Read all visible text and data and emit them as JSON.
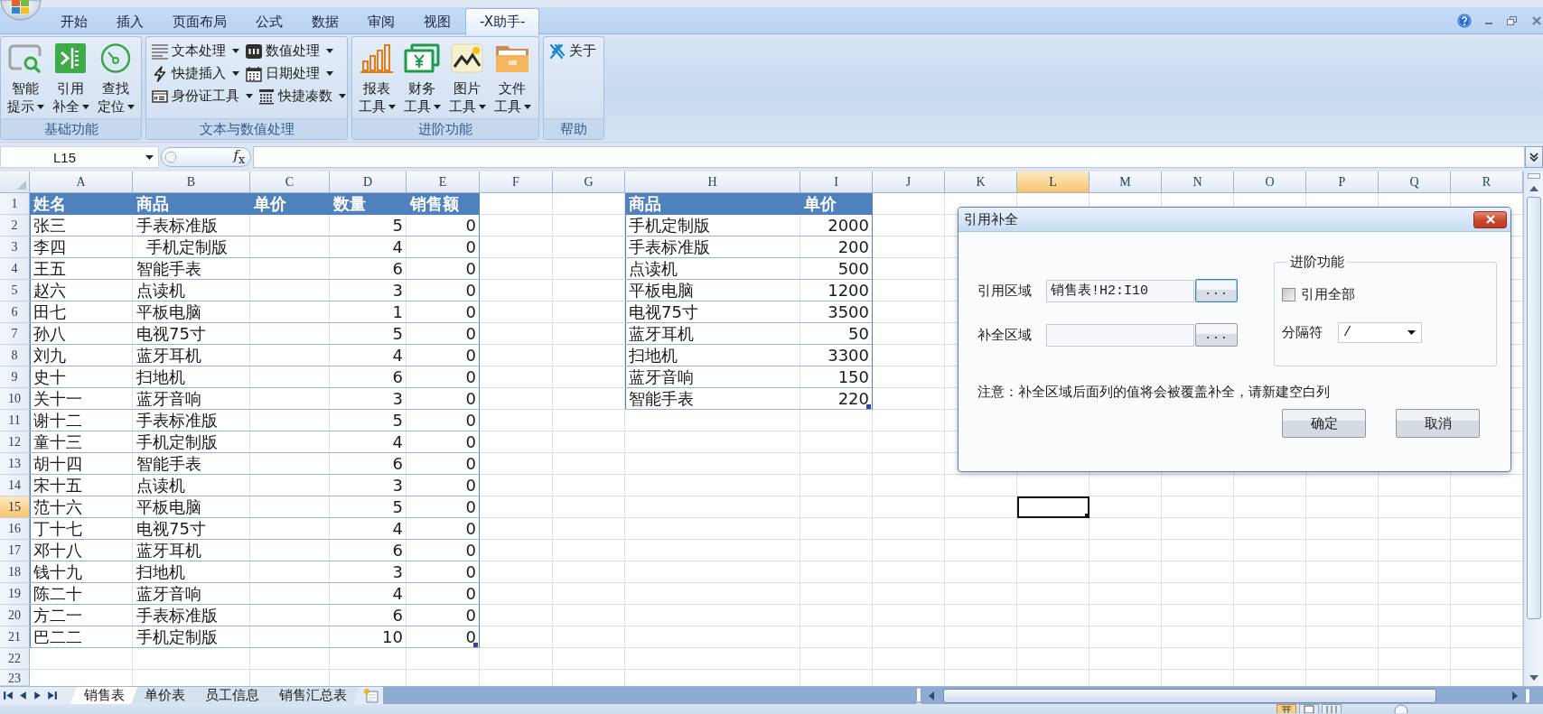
{
  "ribbon_tabs": [
    {
      "label": "开始",
      "selected": false
    },
    {
      "label": "插入",
      "selected": false
    },
    {
      "label": "页面布局",
      "selected": false
    },
    {
      "label": "公式",
      "selected": false
    },
    {
      "label": "数据",
      "selected": false
    },
    {
      "label": "审阅",
      "selected": false
    },
    {
      "label": "视图",
      "selected": false
    },
    {
      "label": "-X助手-",
      "selected": true
    }
  ],
  "ribbon_groups": [
    {
      "title": "基础功能",
      "kind": "large",
      "items": [
        {
          "lines": [
            "智能",
            "提示"
          ],
          "dropdown": true
        },
        {
          "lines": [
            "引用",
            "补全"
          ],
          "dropdown": true
        },
        {
          "lines": [
            "查找",
            "定位"
          ],
          "dropdown": true
        }
      ]
    },
    {
      "title": "文本与数值处理",
      "kind": "small",
      "items": [
        {
          "label": "文本处理",
          "dropdown": true
        },
        {
          "label": "数值处理",
          "dropdown": true
        },
        {
          "label": "快捷插入",
          "dropdown": true
        },
        {
          "label": "日期处理",
          "dropdown": true
        },
        {
          "label": "身份证工具",
          "dropdown": true
        },
        {
          "label": "快捷凑数",
          "dropdown": true
        }
      ]
    },
    {
      "title": "进阶功能",
      "kind": "large",
      "items": [
        {
          "lines": [
            "报表",
            "工具"
          ],
          "dropdown": true
        },
        {
          "lines": [
            "财务",
            "工具"
          ],
          "dropdown": true
        },
        {
          "lines": [
            "图片",
            "工具"
          ],
          "dropdown": true
        },
        {
          "lines": [
            "文件",
            "工具"
          ],
          "dropdown": true
        }
      ]
    },
    {
      "title": "帮助",
      "kind": "small",
      "items": [
        {
          "label": "关于",
          "dropdown": false
        }
      ]
    }
  ],
  "name_box": {
    "value": "L15"
  },
  "formula_bar": {
    "function_label": "*f*$_{x}$"
  },
  "sheet": {
    "columns": [
      {
        "label": "A",
        "selected": false
      },
      {
        "label": "B",
        "selected": false
      },
      {
        "label": "C",
        "selected": false
      },
      {
        "label": "D",
        "selected": false
      },
      {
        "label": "E",
        "selected": false
      },
      {
        "label": "F",
        "selected": false
      },
      {
        "label": "G",
        "selected": false
      },
      {
        "label": "H",
        "selected": false
      },
      {
        "label": "I",
        "selected": false
      },
      {
        "label": "J",
        "selected": false
      },
      {
        "label": "K",
        "selected": false
      },
      {
        "label": "L",
        "selected": true
      },
      {
        "label": "M",
        "selected": false
      },
      {
        "label": "N",
        "selected": false
      },
      {
        "label": "O",
        "selected": false
      },
      {
        "label": "P",
        "selected": false
      },
      {
        "label": "Q",
        "selected": false
      },
      {
        "label": "R",
        "selected": false
      }
    ],
    "row_headers": [
      {
        "label": "1",
        "selected": false
      },
      {
        "label": "2",
        "selected": false
      },
      {
        "label": "3",
        "selected": false
      },
      {
        "label": "4",
        "selected": false
      },
      {
        "label": "5",
        "selected": false
      },
      {
        "label": "6",
        "selected": false
      },
      {
        "label": "7",
        "selected": false
      },
      {
        "label": "8",
        "selected": false
      },
      {
        "label": "9",
        "selected": false
      },
      {
        "label": "10",
        "selected": false
      },
      {
        "label": "11",
        "selected": false
      },
      {
        "label": "12",
        "selected": false
      },
      {
        "label": "13",
        "selected": false
      },
      {
        "label": "14",
        "selected": false
      },
      {
        "label": "15",
        "selected": true
      },
      {
        "label": "16",
        "selected": false
      },
      {
        "label": "17",
        "selected": false
      },
      {
        "label": "18",
        "selected": false
      },
      {
        "label": "19",
        "selected": false
      },
      {
        "label": "20",
        "selected": false
      },
      {
        "label": "21",
        "selected": false
      },
      {
        "label": "22",
        "selected": false
      },
      {
        "label": "23",
        "selected": false
      }
    ],
    "tables": [
      {
        "columns": [
          {
            "header": "姓名",
            "kind": "text"
          },
          {
            "header": "商品",
            "kind": "text"
          },
          {
            "header": "单价",
            "kind": "number"
          },
          {
            "header": "数量",
            "kind": "number"
          },
          {
            "header": "销售额",
            "kind": "number"
          }
        ],
        "rows": [
          [
            "张三",
            "手表标准版",
            null,
            "5",
            "0"
          ],
          [
            "李四",
            "  手机定制版",
            null,
            "4",
            "0"
          ],
          [
            "王五",
            "智能手表",
            null,
            "6",
            "0"
          ],
          [
            "赵六",
            "点读机",
            null,
            "3",
            "0"
          ],
          [
            "田七",
            "平板电脑",
            null,
            "1",
            "0"
          ],
          [
            "孙八",
            "电视75寸",
            null,
            "5",
            "0"
          ],
          [
            "刘九",
            "蓝牙耳机",
            null,
            "4",
            "0"
          ],
          [
            "史十",
            "扫地机",
            null,
            "6",
            "0"
          ],
          [
            "关十一",
            "蓝牙音响",
            null,
            "3",
            "0"
          ],
          [
            "谢十二",
            "手表标准版",
            null,
            "5",
            "0"
          ],
          [
            "童十三",
            "手机定制版",
            null,
            "4",
            "0"
          ],
          [
            "胡十四",
            "智能手表",
            null,
            "6",
            "0"
          ],
          [
            "宋十五",
            "点读机",
            null,
            "3",
            "0"
          ],
          [
            "范十六",
            "平板电脑",
            null,
            "5",
            "0"
          ],
          [
            "丁十七",
            "电视75寸",
            null,
            "4",
            "0"
          ],
          [
            "邓十八",
            "蓝牙耳机",
            null,
            "6",
            "0"
          ],
          [
            "钱十九",
            "扫地机",
            null,
            "3",
            "0"
          ],
          [
            "陈二十",
            "蓝牙音响",
            null,
            "4",
            "0"
          ],
          [
            "方二一",
            "手表标准版",
            null,
            "6",
            "0"
          ],
          [
            "巴二二",
            "手机定制版",
            null,
            "10",
            "0"
          ]
        ]
      },
      {
        "columns": [
          {
            "header": "商品",
            "kind": "text"
          },
          {
            "header": "单价",
            "kind": "number"
          }
        ],
        "rows": [
          [
            "手机定制版",
            "2000"
          ],
          [
            "手表标准版",
            "200"
          ],
          [
            "点读机",
            "500"
          ],
          [
            "平板电脑",
            "1200"
          ],
          [
            "电视75寸",
            "3500"
          ],
          [
            "蓝牙耳机",
            "50"
          ],
          [
            "扫地机",
            "3300"
          ],
          [
            "蓝牙音响",
            "150"
          ],
          [
            "智能手表",
            "220"
          ]
        ]
      }
    ]
  },
  "dialog": {
    "title": "引用补全",
    "fields": [
      {
        "label": "引用区域",
        "value": "销售表!H2:I10",
        "button": "...",
        "focused": true
      },
      {
        "label": "补全区域",
        "button": "...",
        "focused": false
      }
    ],
    "options": {
      "title": "进阶功能",
      "checkbox": {
        "label": "引用全部",
        "checked": false
      },
      "separator": {
        "label": "分隔符",
        "value": "/"
      }
    },
    "note": "注意：补全区域后面列的值将会被覆盖补全，请新建空白列",
    "buttons": [
      "确定",
      "取消"
    ]
  },
  "sheet_tabs": [
    {
      "label": "销售表",
      "selected": true
    },
    {
      "label": "单价表",
      "selected": false
    },
    {
      "label": "员工信息",
      "selected": false
    },
    {
      "label": "销售汇总表",
      "selected": false
    }
  ],
  "status_bar": {
    "views": [
      {
        "selected": true
      },
      {
        "selected": false
      },
      {
        "selected": false
      }
    ]
  }
}
